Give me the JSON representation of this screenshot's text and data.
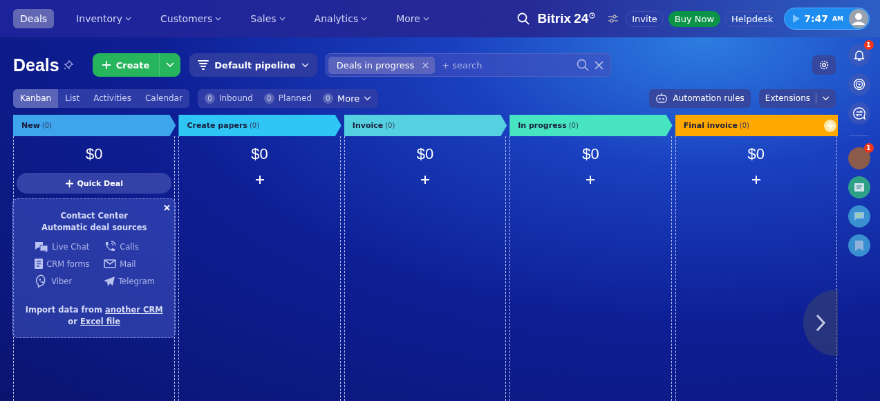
{
  "nav": [
    {
      "label": "Deals",
      "selected": true,
      "dropdown": false
    },
    {
      "label": "Inventory",
      "selected": false,
      "dropdown": true
    },
    {
      "label": "Customers",
      "selected": false,
      "dropdown": true
    },
    {
      "label": "Sales",
      "selected": false,
      "dropdown": true
    },
    {
      "label": "Analytics",
      "selected": false,
      "dropdown": true
    },
    {
      "label": "More",
      "selected": false,
      "dropdown": true
    }
  ],
  "header": {
    "logo": "Bitrix",
    "logo_number": "24",
    "invite": "Invite",
    "buy_now": "Buy Now",
    "helpdesk": "Helpdesk",
    "time": "7:47",
    "ampm": "AM"
  },
  "page_title": "Deals",
  "create_button": "Create",
  "pipeline": "Default pipeline",
  "filter": {
    "chip": "Deals in progress",
    "placeholder": "+ search"
  },
  "view_tabs": [
    {
      "label": "Kanban",
      "selected": true
    },
    {
      "label": "List",
      "selected": false
    },
    {
      "label": "Activities",
      "selected": false
    },
    {
      "label": "Calendar",
      "selected": false
    }
  ],
  "counters": [
    {
      "count": "0",
      "label": "Inbound"
    },
    {
      "count": "0",
      "label": "Planned"
    },
    {
      "count": "0",
      "label": "More"
    }
  ],
  "automation": "Automation rules",
  "extensions": "Extensions",
  "columns": [
    {
      "name": "New",
      "count": "(0)",
      "color": "#3ea4ec",
      "total": "$0"
    },
    {
      "name": "Create papers",
      "count": "(0)",
      "color": "#2fc6f6",
      "total": "$0"
    },
    {
      "name": "Invoice",
      "count": "(0)",
      "color": "#55d0e0",
      "total": "$0"
    },
    {
      "name": "In progress",
      "count": "(0)",
      "color": "#47e4c2",
      "total": "$0"
    },
    {
      "name": "Final invoice",
      "count": "(0)",
      "color": "#ffa900",
      "total": "$0"
    }
  ],
  "quick_deal": "Quick Deal",
  "contact_center": {
    "title": "Contact Center",
    "subtitle": "Automatic deal sources",
    "sources": [
      {
        "kind": "chat",
        "label": "Live Chat"
      },
      {
        "kind": "calls",
        "label": "Calls"
      },
      {
        "kind": "forms",
        "label": "CRM forms"
      },
      {
        "kind": "mail",
        "label": "Mail"
      },
      {
        "kind": "viber",
        "label": "Viber"
      },
      {
        "kind": "telegram",
        "label": "Telegram"
      }
    ],
    "import_prefix": "Import data from",
    "import_link_1": "another CRM",
    "import_middle": "or",
    "import_link_2": "Excel file"
  },
  "sidebar": {
    "notification_badge": "1",
    "avatar_badge": "1"
  }
}
